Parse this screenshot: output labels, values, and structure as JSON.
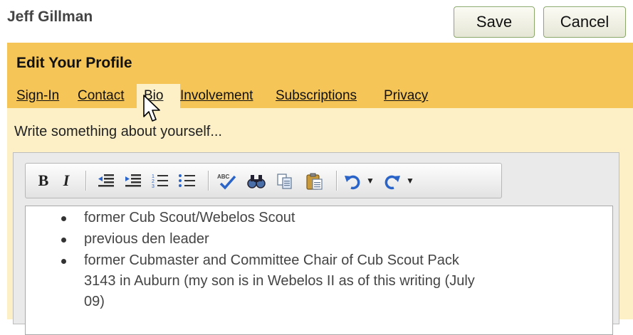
{
  "header": {
    "user_name": "Jeff Gillman"
  },
  "actions": {
    "save_label": "Save",
    "cancel_label": "Cancel"
  },
  "panel": {
    "title": "Edit Your Profile",
    "tabs": [
      {
        "label": "Sign-In"
      },
      {
        "label": "Contact"
      },
      {
        "label": "Bio",
        "active": true
      },
      {
        "label": "Involvement"
      },
      {
        "label": "Subscriptions"
      },
      {
        "label": "Privacy"
      }
    ],
    "prompt": "Write something about yourself..."
  },
  "editor": {
    "toolbar": {
      "bold_label": "B",
      "italic_label": "I",
      "buttons": [
        "bold",
        "italic",
        "outdent-icon",
        "indent-icon",
        "numbered-list-icon",
        "bulleted-list-icon",
        "spellcheck-icon",
        "find-icon",
        "copy-icon",
        "paste-icon",
        "undo-icon",
        "redo-icon"
      ]
    },
    "content": {
      "items": [
        "former Cub Scout/Webelos Scout",
        "previous den leader",
        "former Cubmaster and Committee Chair of Cub Scout Pack",
        "3143 in Auburn (my son is in Webelos II as of this writing (July",
        "09)"
      ]
    }
  },
  "colors": {
    "panel_background": "#f6c558",
    "content_background": "#fdf0c6",
    "button_border": "#8aa86a",
    "toolbar_icon_blue": "#2b64c8"
  }
}
